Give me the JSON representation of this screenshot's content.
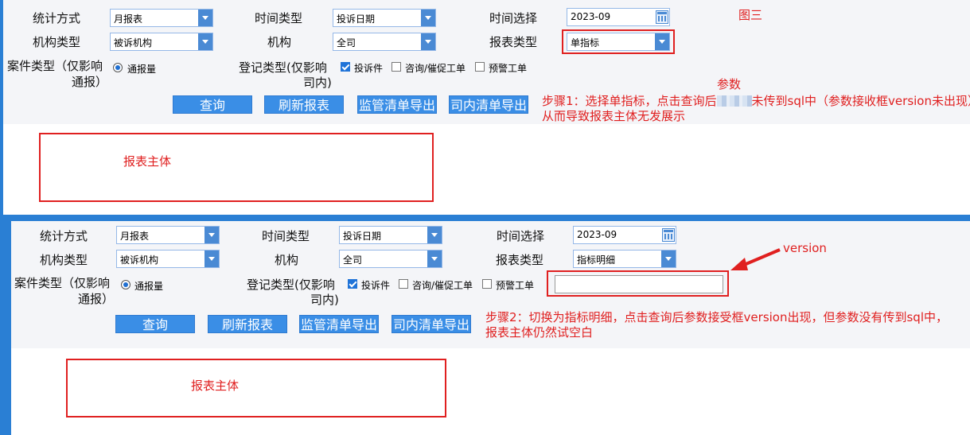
{
  "panel1": {
    "stat_method": {
      "label": "统计方式",
      "value": "月报表"
    },
    "time_type": {
      "label": "时间类型",
      "value": "投诉日期"
    },
    "time_select": {
      "label": "时间选择",
      "value": "2023-09"
    },
    "org_type": {
      "label": "机构类型",
      "value": "被诉机构"
    },
    "org": {
      "label": "机构",
      "value": "全司"
    },
    "report_type": {
      "label": "报表类型",
      "value": "单指标"
    },
    "case_type": {
      "label_line1": "案件类型（仅影响",
      "label_line2": "通报）",
      "option": "通报量"
    },
    "reg_type": {
      "label_line1": "登记类型(仅影响",
      "label_line2": "司内)",
      "options": [
        "投诉件",
        "咨询/催促工单",
        "预警工单"
      ]
    },
    "buttons": [
      "查询",
      "刷新报表",
      "监管清单导出",
      "司内清单导出"
    ],
    "fig_label": "图三",
    "param_note": "参数",
    "step_note_a": "步骤1：选择单指标，点击查询后",
    "step_note_b": "未传到sql中（参数接收框version未出现），",
    "step_note_line2": "从而导致报表主体无发展示",
    "report_body": "报表主体"
  },
  "panel2": {
    "stat_method": {
      "label": "统计方式",
      "value": "月报表"
    },
    "time_type": {
      "label": "时间类型",
      "value": "投诉日期"
    },
    "time_select": {
      "label": "时间选择",
      "value": "2023-09"
    },
    "org_type": {
      "label": "机构类型",
      "value": "被诉机构"
    },
    "org": {
      "label": "机构",
      "value": "全司"
    },
    "report_type": {
      "label": "报表类型",
      "value": "指标明细"
    },
    "case_type": {
      "label_line1": "案件类型（仅影响",
      "label_line2": "通报）",
      "option": "通报量"
    },
    "reg_type": {
      "label_line1": "登记类型(仅影响",
      "label_line2": "司内)",
      "options": [
        "投诉件",
        "咨询/催促工单",
        "预警工单"
      ]
    },
    "version_value": "",
    "version_note": "version",
    "buttons": [
      "查询",
      "刷新报表",
      "监管清单导出",
      "司内清单导出"
    ],
    "step_note_line1": "步骤2：切换为指标明细，点击查询后参数接受框version出现，但参数没有传到sql中，",
    "step_note_line2": "报表主体仍然试空白",
    "report_body": "报表主体"
  },
  "colors": {
    "accent": "#3a8ee6",
    "annotation": "#e02020"
  }
}
